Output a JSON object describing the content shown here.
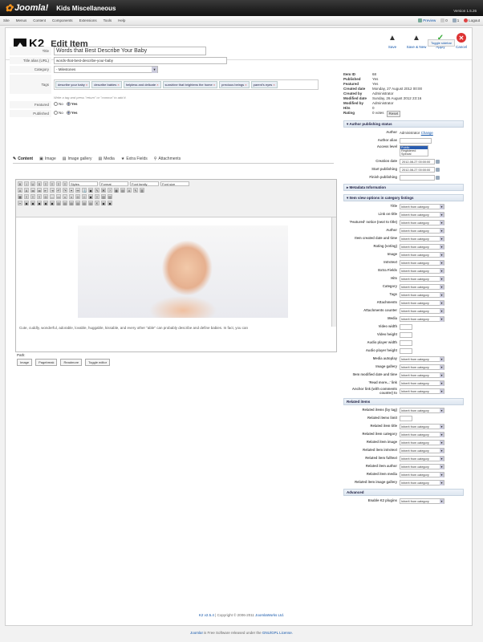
{
  "header": {
    "logo": "Joomla!",
    "site": "Kids Miscellaneous",
    "version": "Version 1.5.26"
  },
  "menu": [
    "Site",
    "Menus",
    "Content",
    "Components",
    "Extensions",
    "Tools",
    "Help"
  ],
  "status": {
    "preview": "Preview",
    "messages": "0",
    "users": "1",
    "logout": "Logout"
  },
  "toolbar": {
    "k2": "K2",
    "title": "Edit Item",
    "save": "Save",
    "save_new": "Save & New",
    "apply": "Apply",
    "cancel": "Cancel"
  },
  "toggle_sidebar": "Toggle sidebar",
  "form": {
    "title_label": "Title",
    "title": "Words that Best Describe Your Baby",
    "alias_label": "Title alias (URL)",
    "alias": "words-that-best-describe-your-baby",
    "category_label": "Category",
    "category": "- Milestones",
    "tags_label": "Tags",
    "tags": [
      "describe your baby",
      "describe babies",
      "helpless and delicate",
      "sunshine that brightens the home",
      "precious beings",
      "parent's eyes"
    ],
    "tags_hint": "Write a tag and press \"return\" or \"comma\" to add it.",
    "featured_label": "Featured",
    "published_label": "Published",
    "no": "No",
    "yes": "Yes"
  },
  "tabs": [
    "Content",
    "Image",
    "Image gallery",
    "Media",
    "Extra Fields",
    "Attachments"
  ],
  "editor": {
    "styles": "Styles",
    "format": "Format",
    "font_family": "Font family",
    "font_size": "Font size",
    "text": "Cute, cuddly, wonderful, adorable, lovable, huggable, kissable, and every other \"able\" can probably describe and define babies. In fact, you can",
    "path": "Path:",
    "buttons": [
      "Image",
      "Pagebreak",
      "Readmore",
      "Toggle editor"
    ]
  },
  "info": [
    {
      "k": "Item ID",
      "v": "68"
    },
    {
      "k": "Published",
      "v": "Yes"
    },
    {
      "k": "Featured",
      "v": "Yes"
    },
    {
      "k": "Created date",
      "v": "Monday, 27 August 2012 00:00"
    },
    {
      "k": "Created by",
      "v": "Administrator"
    },
    {
      "k": "Modified date",
      "v": "Sunday, 26 August 2012 23:16"
    },
    {
      "k": "Modified by",
      "v": "Administrator"
    },
    {
      "k": "Hits",
      "v": "0"
    },
    {
      "k": "Rating",
      "v": "0 votes"
    }
  ],
  "reset": "Reset",
  "author_section": "Author publishing status",
  "author": {
    "label": "Author",
    "value": "Administrator",
    "change": "Change"
  },
  "author_alias": "Author alias",
  "access": {
    "label": "Access level",
    "options": [
      "Public",
      "Registered",
      "Special"
    ]
  },
  "creation_date": {
    "label": "Creation date",
    "value": "2012-08-27 00:00:00"
  },
  "start_publishing": {
    "label": "Start publishing",
    "value": "2012-08-27 00:00:00"
  },
  "finish_publishing": "Finish publishing",
  "metadata_section": "Metadata Information",
  "view_section": "Item view options in category listings",
  "inherit": "Inherit from category",
  "view_options": [
    "Title",
    "Link on title",
    "'Featured' notice (next to title)",
    "Author",
    "Item created date and time",
    "Rating (voting)",
    "Image",
    "Introtext",
    "Extra Fields",
    "Hits",
    "Category",
    "Tags",
    "Attachments",
    "Attachments counter",
    "Media"
  ],
  "view_inputs": [
    "Video width",
    "Video height",
    "Audio player width",
    "Audio player height"
  ],
  "view_options2": [
    "Media autoplay",
    "Image gallery",
    "Item modified date and time",
    "'Read more...' link",
    "Anchor link (with comments counter) to"
  ],
  "related_section": "Related items",
  "related": [
    "Related items (by tag)"
  ],
  "related_limit": "Related items limit",
  "related2": [
    "Related item title",
    "Related item category",
    "Related item image",
    "Related item introtext",
    "Related item fulltext",
    "Related item author",
    "Related item media",
    "Related item image gallery"
  ],
  "advanced_section": "Advanced",
  "advanced": [
    "Enable K2 plugins"
  ],
  "footer": {
    "k2": "K2 v2.5.4",
    "copyright": " | Copyright © 2006-2011 ",
    "jw": "JoomlaWorks Ltd.",
    "joomla": "Joomla!",
    "free": " is Free Software released under the ",
    "gnu": "GNU/GPL License."
  },
  "colors": {
    "accent": "#1155aa",
    "header": "#111111",
    "section": "#dde6f0",
    "flower": "#f7941d"
  }
}
